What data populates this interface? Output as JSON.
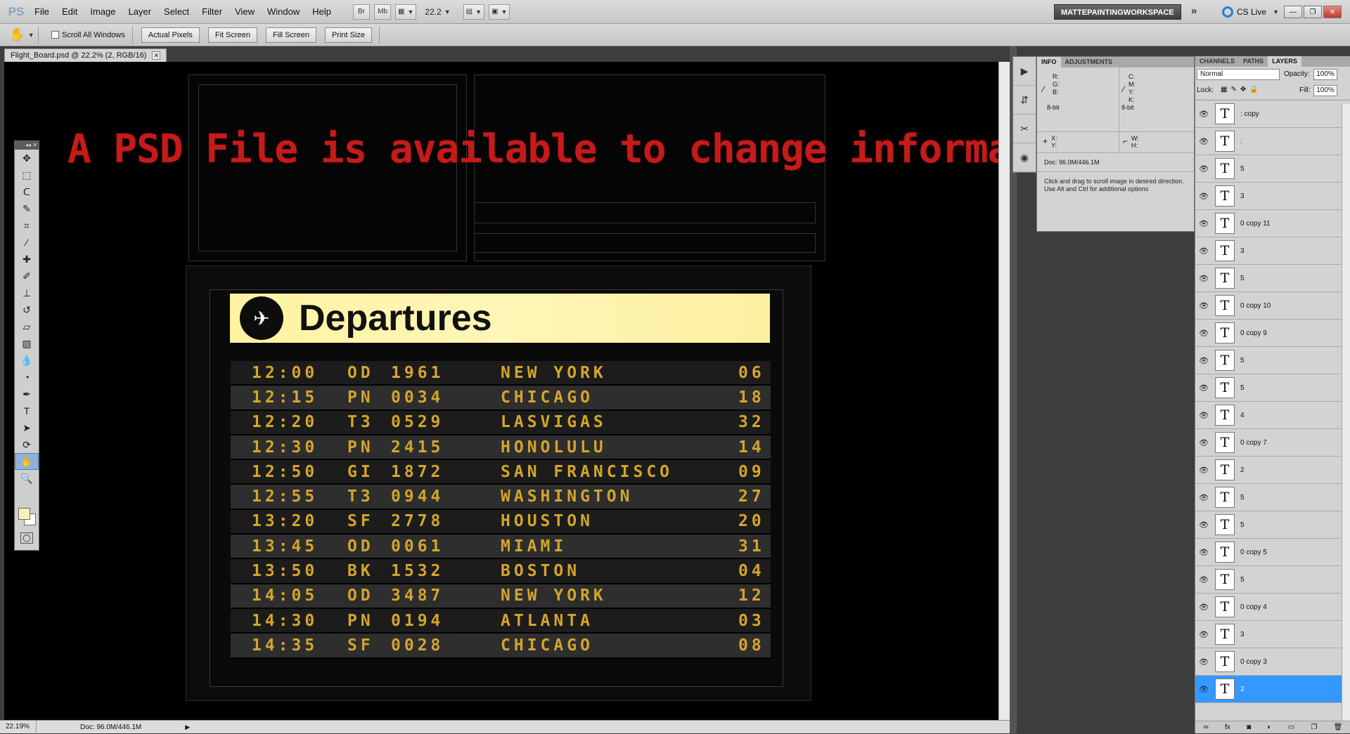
{
  "app": {
    "logo": "PS"
  },
  "menu": [
    "File",
    "Edit",
    "Image",
    "Layer",
    "Select",
    "Filter",
    "View",
    "Window",
    "Help"
  ],
  "menubar_buttons": [
    "Br",
    "Mb"
  ],
  "zoom_level": "22.2",
  "workspace": "MATTEPAINTINGWORKSPACE",
  "cs_live": "CS Live",
  "options": {
    "scroll_all": "Scroll All Windows",
    "buttons": [
      "Actual Pixels",
      "Fit Screen",
      "Fill Screen",
      "Print Size"
    ]
  },
  "document": {
    "tab_title": "Flight_Board.psd @ 22.2% (2, RGB/16)"
  },
  "canvas": {
    "headline": "A PSD File is available to change informations",
    "departures_title": "Departures",
    "flights": [
      {
        "time": "12:00",
        "code": "OD",
        "num": "1961",
        "city": "NEW YORK",
        "gate": "06"
      },
      {
        "time": "12:15",
        "code": "PN",
        "num": "0034",
        "city": "CHICAGO",
        "gate": "18"
      },
      {
        "time": "12:20",
        "code": "T3",
        "num": "0529",
        "city": "LASVIGAS",
        "gate": "32"
      },
      {
        "time": "12:30",
        "code": "PN",
        "num": "2415",
        "city": "HONOLULU",
        "gate": "14"
      },
      {
        "time": "12:50",
        "code": "GI",
        "num": "1872",
        "city": "SAN FRANCISCO",
        "gate": "09"
      },
      {
        "time": "12:55",
        "code": "T3",
        "num": "0944",
        "city": "WASHINGTON",
        "gate": "27"
      },
      {
        "time": "13:20",
        "code": "SF",
        "num": "2778",
        "city": "HOUSTON",
        "gate": "20"
      },
      {
        "time": "13:45",
        "code": "OD",
        "num": "0061",
        "city": "MIAMI",
        "gate": "31"
      },
      {
        "time": "13:50",
        "code": "BK",
        "num": "1532",
        "city": "BOSTON",
        "gate": "04"
      },
      {
        "time": "14:05",
        "code": "OD",
        "num": "3487",
        "city": "NEW YORK",
        "gate": "12"
      },
      {
        "time": "14:30",
        "code": "PN",
        "num": "0194",
        "city": "ATLANTA",
        "gate": "03"
      },
      {
        "time": "14:35",
        "code": "SF",
        "num": "0028",
        "city": "CHICAGO",
        "gate": "08"
      }
    ]
  },
  "status": {
    "zoom": "22.19%",
    "doc": "Doc: 96.0M/446.1M"
  },
  "info_panel": {
    "tabs": [
      "INFO",
      "ADJUSTMENTS"
    ],
    "rgb_labels": [
      "R:",
      "G:",
      "B:"
    ],
    "cmyk_labels": [
      "C:",
      "M:",
      "Y:",
      "K:"
    ],
    "bit_left": "8-bit",
    "bit_right": "8-bit",
    "xy_labels": [
      "X:",
      "Y:"
    ],
    "wh_labels": [
      "W:",
      "H:"
    ],
    "doc": "Doc: 96.0M/446.1M",
    "message": "Click and drag to scroll image in desired direction.  Use Alt and Ctrl for additional options"
  },
  "layers_panel": {
    "tabs": [
      "CHANNELS",
      "PATHS",
      "LAYERS"
    ],
    "blend_mode": "Normal",
    "opacity_label": "Opacity:",
    "opacity": "100%",
    "lock_label": "Lock:",
    "fill_label": "Fill:",
    "fill": "100%",
    "layers": [
      ": copy",
      ":",
      "5",
      "3",
      "0 copy 11",
      "3",
      "5",
      "0 copy 10",
      "0 copy 9",
      "5",
      "5",
      "4",
      "0 copy 7",
      "2",
      "5",
      "5",
      "0 copy 5",
      "5",
      "0 copy 4",
      "3",
      "0 copy 3",
      "2"
    ],
    "selected_index": 21
  }
}
